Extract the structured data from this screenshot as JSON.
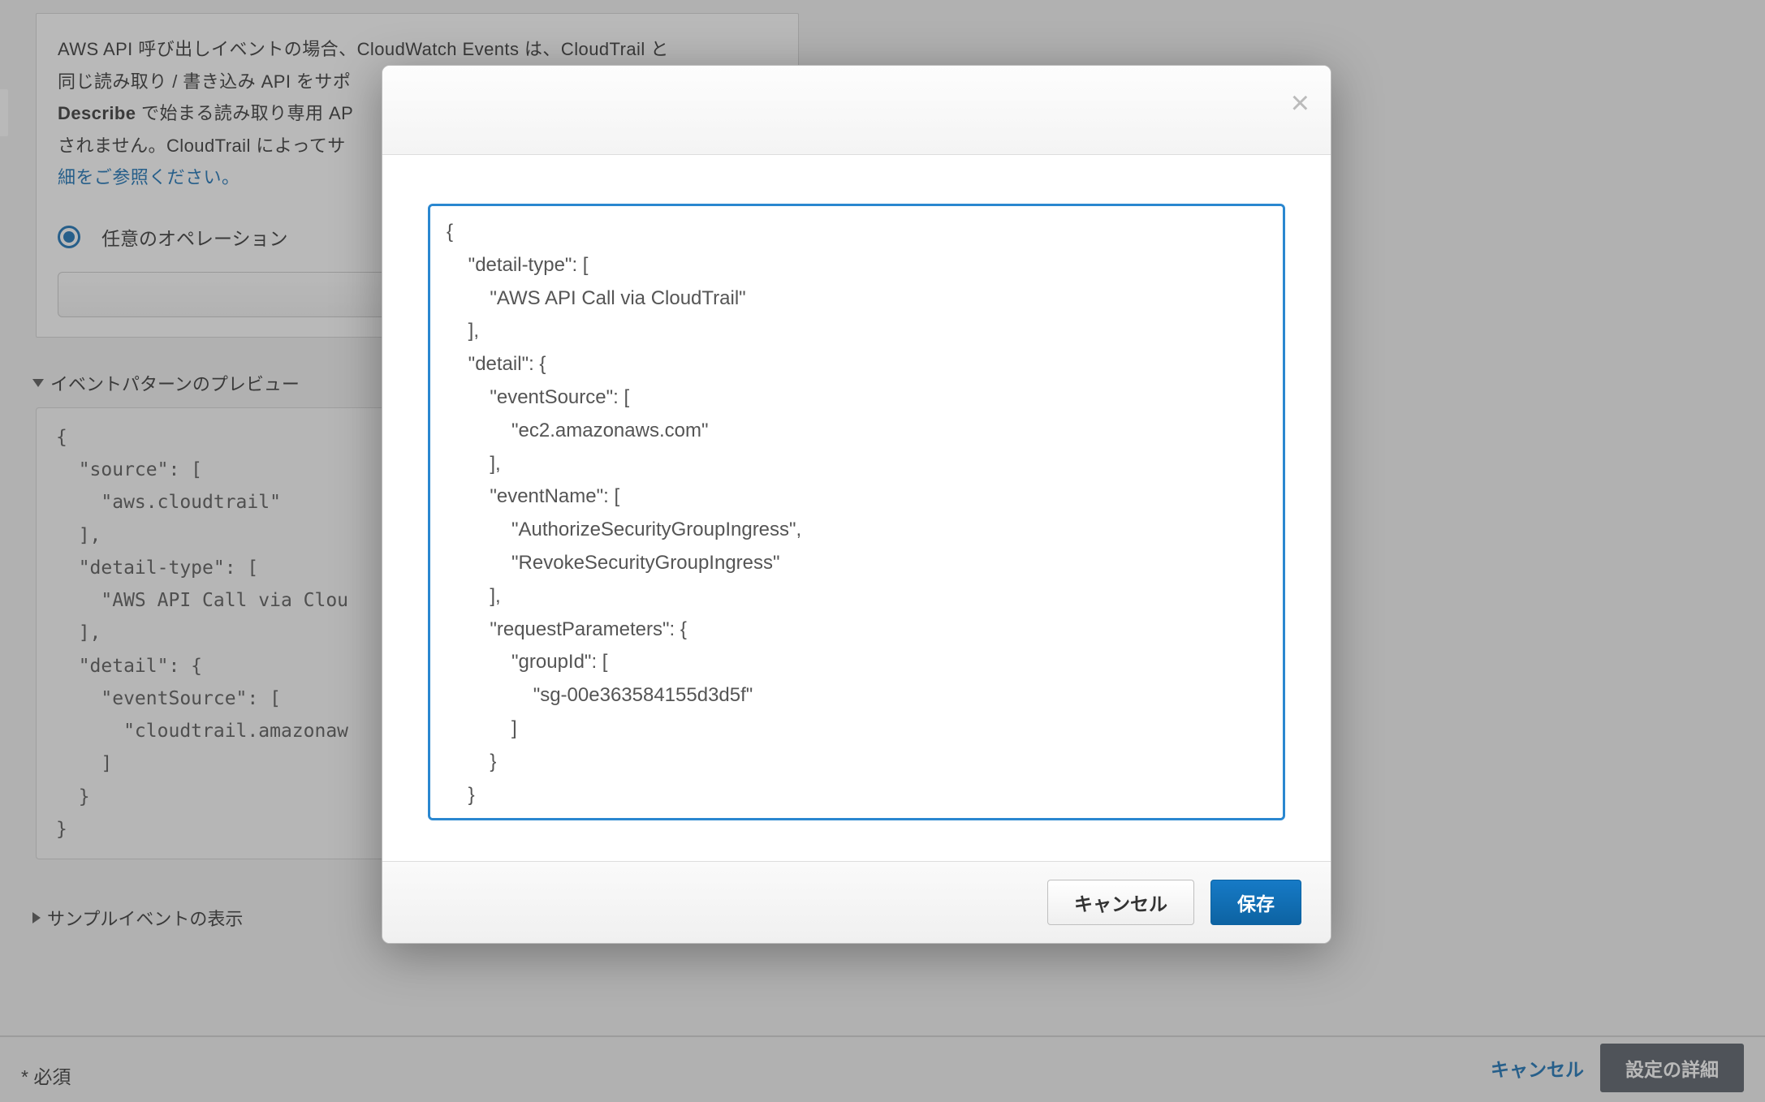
{
  "card": {
    "text_line1_prefix": "AWS API 呼び出しイベントの場合、CloudWatch Events は、CloudTrail と",
    "text_line2": "同じ読み取り / 書き込み API をサポ",
    "describe_label": "Describe",
    "text_line3": " で始まる読み取り専用 AP",
    "text_line4": "されません。CloudTrail によってサ",
    "link_text": "細をご参照ください。",
    "radio_label": "任意のオペレーション"
  },
  "preview": {
    "title": "イベントパターンのプレビュー",
    "json": "{\n  \"source\": [\n    \"aws.cloudtrail\"\n  ],\n  \"detail-type\": [\n    \"AWS API Call via Clou\n  ],\n  \"detail\": {\n    \"eventSource\": [\n      \"cloudtrail.amazonaw\n    ]\n  }\n}"
  },
  "sample": {
    "title": "サンプルイベントの表示"
  },
  "required_label": "* 必須",
  "page_footer": {
    "cancel": "キャンセル",
    "details": "設定の詳細"
  },
  "modal": {
    "editor_value": "{\n    \"detail-type\": [\n        \"AWS API Call via CloudTrail\"\n    ],\n    \"detail\": {\n        \"eventSource\": [\n            \"ec2.amazonaws.com\"\n        ],\n        \"eventName\": [\n            \"AuthorizeSecurityGroupIngress\",\n            \"RevokeSecurityGroupIngress\"\n        ],\n        \"requestParameters\": {\n            \"groupId\": [\n                \"sg-00e363584155d3d5f\"\n            ]\n        }\n    }\n}",
    "cancel_label": "キャンセル",
    "save_label": "保存"
  }
}
